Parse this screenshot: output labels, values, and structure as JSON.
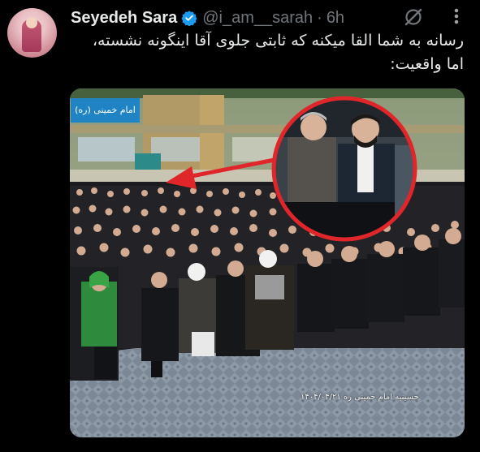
{
  "tweet": {
    "display_name": "Seyedeh Sara",
    "handle": "@i_am__sarah",
    "separator": "·",
    "time": "6h",
    "text_lines": [
      "رسانه به شما القا میکنه که ثابتی جلوی آقا اینگونه نشسته،",
      "اما واقعیت:"
    ]
  },
  "media": {
    "banner_text": "امام خمینی (ره)",
    "caption_text": "حسینیه امام خمینی ره ۱۴۰۴/۰۴/۲۱"
  },
  "icons": {
    "verified": "verified-badge-icon",
    "grok": "grok-icon",
    "more": "more-options-icon",
    "avatar": "avatar-image"
  },
  "colors": {
    "background": "#000000",
    "text": "#e7e9ea",
    "secondary_text": "#71767b",
    "verified_blue": "#1d9bf0",
    "highlight_circle": "#e0262a",
    "arrow": "#e0262a"
  }
}
